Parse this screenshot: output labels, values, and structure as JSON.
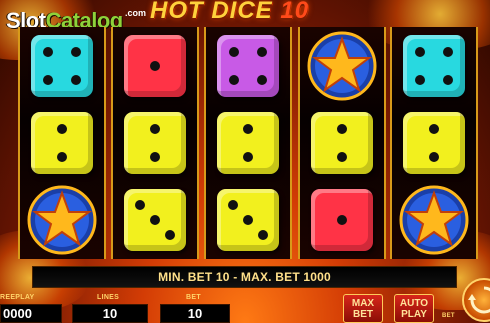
{
  "logo": {
    "slot": "Slot",
    "catalog": "Catalog",
    "com": ".com"
  },
  "title": {
    "main": "HOT DICE",
    "number": "10"
  },
  "reels": [
    [
      {
        "type": "die",
        "color": "#28d9e0",
        "pips": 4
      },
      {
        "type": "die",
        "color": "#f2f01e",
        "pips": 2
      },
      {
        "type": "star"
      }
    ],
    [
      {
        "type": "die",
        "color": "#ff3346",
        "pips": 1
      },
      {
        "type": "die",
        "color": "#f2f01e",
        "pips": 2
      },
      {
        "type": "die",
        "color": "#f2f01e",
        "pips": 3
      }
    ],
    [
      {
        "type": "die",
        "color": "#c85ae6",
        "pips": 4
      },
      {
        "type": "die",
        "color": "#f2f01e",
        "pips": 2
      },
      {
        "type": "die",
        "color": "#f2f01e",
        "pips": 3
      }
    ],
    [
      {
        "type": "star"
      },
      {
        "type": "die",
        "color": "#f2f01e",
        "pips": 2
      },
      {
        "type": "die",
        "color": "#ff3346",
        "pips": 1
      }
    ],
    [
      {
        "type": "die",
        "color": "#28d9e0",
        "pips": 4
      },
      {
        "type": "die",
        "color": "#f2f01e",
        "pips": 2
      },
      {
        "type": "star"
      }
    ]
  ],
  "message": "MIN. BET 10 - MAX. BET 1000",
  "freeplay": {
    "label": "REEPLAY",
    "value": "0000"
  },
  "lines": {
    "label": "LINES",
    "value": "10"
  },
  "bet": {
    "label": "BET",
    "value": "10"
  },
  "buttons": {
    "max_bet": "MAX BET",
    "auto_play": "AUTO PLAY",
    "bet_small": "BET"
  },
  "colors": {
    "frame": "#d89a1a",
    "label": "#ffd56a",
    "star_blue": "#2a5fe0",
    "star_gold": "#ffb81c"
  }
}
